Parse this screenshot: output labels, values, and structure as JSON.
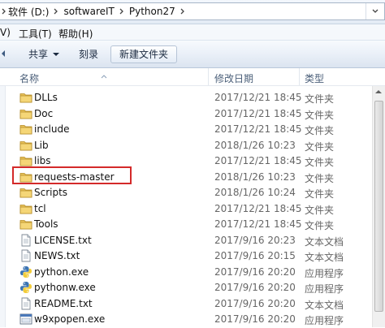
{
  "address": {
    "crumbs": [
      "软件 (D:)",
      "softwareIT",
      "Python27"
    ]
  },
  "menu": {
    "items": [
      "V)",
      "工具(T)",
      "帮助(H)"
    ]
  },
  "toolbar": {
    "share_label": "共享",
    "burn_label": "刻录",
    "new_folder_label": "新建文件夹"
  },
  "columns": {
    "name": "名称",
    "date": "修改日期",
    "type": "类型"
  },
  "files": [
    {
      "name": "DLLs",
      "date": "2017/12/21 18:45",
      "type": "文件夹",
      "icon": "folder-icon"
    },
    {
      "name": "Doc",
      "date": "2017/12/21 18:45",
      "type": "文件夹",
      "icon": "folder-icon"
    },
    {
      "name": "include",
      "date": "2017/12/21 18:45",
      "type": "文件夹",
      "icon": "folder-icon"
    },
    {
      "name": "Lib",
      "date": "2018/1/26 10:23",
      "type": "文件夹",
      "icon": "folder-icon"
    },
    {
      "name": "libs",
      "date": "2017/12/21 18:45",
      "type": "文件夹",
      "icon": "folder-icon"
    },
    {
      "name": "requests-master",
      "date": "2018/1/26 10:23",
      "type": "文件夹",
      "icon": "folder-icon"
    },
    {
      "name": "Scripts",
      "date": "2018/1/26 10:24",
      "type": "文件夹",
      "icon": "folder-icon"
    },
    {
      "name": "tcl",
      "date": "2017/12/21 18:45",
      "type": "文件夹",
      "icon": "folder-icon"
    },
    {
      "name": "Tools",
      "date": "2017/12/21 18:45",
      "type": "文件夹",
      "icon": "folder-icon"
    },
    {
      "name": "LICENSE.txt",
      "date": "2017/9/16 20:23",
      "type": "文本文档",
      "icon": "text-file-icon"
    },
    {
      "name": "NEWS.txt",
      "date": "2017/9/16 20:15",
      "type": "文本文档",
      "icon": "text-file-icon"
    },
    {
      "name": "python.exe",
      "date": "2017/9/16 20:20",
      "type": "应用程序",
      "icon": "python-icon"
    },
    {
      "name": "pythonw.exe",
      "date": "2017/9/16 20:20",
      "type": "应用程序",
      "icon": "python-icon"
    },
    {
      "name": "README.txt",
      "date": "2017/9/16 20:20",
      "type": "文本文档",
      "icon": "text-file-icon"
    },
    {
      "name": "w9xpopen.exe",
      "date": "2017/9/16 20:20",
      "type": "应用程序",
      "icon": "exe-icon"
    }
  ],
  "highlighted_item": "requests-master"
}
